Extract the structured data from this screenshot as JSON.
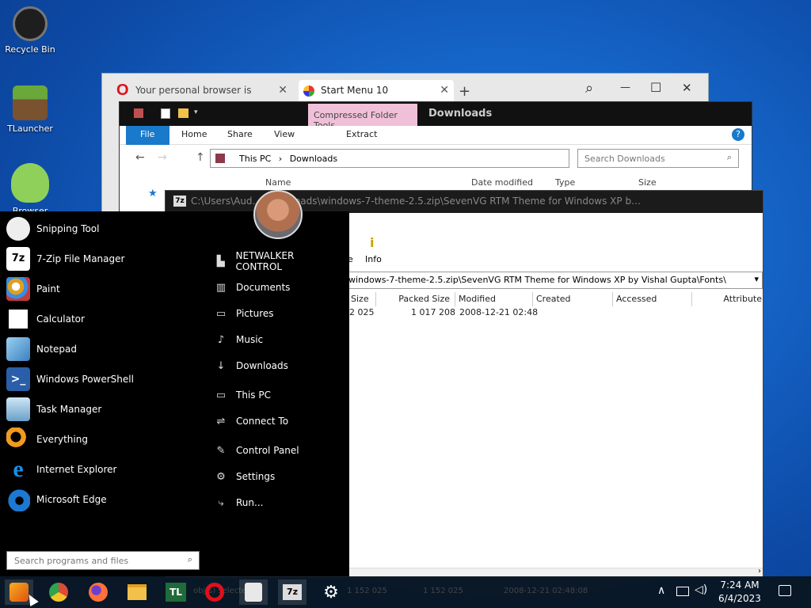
{
  "desktop": {
    "icons": [
      {
        "label": "Recycle Bin",
        "color": "#2a2a2a"
      },
      {
        "label": "TLauncher",
        "color": "#5b8a2e"
      },
      {
        "label": "Browser",
        "color": "#7fc04a"
      }
    ]
  },
  "opera": {
    "tabs": [
      {
        "title": "Your personal browser is"
      },
      {
        "title": "Start Menu 10"
      }
    ],
    "new_tab": "+",
    "search": "⌕",
    "minimize": "—",
    "maximize": "☐",
    "close": "✕",
    "tab_close": "✕"
  },
  "explorer": {
    "title": "Downloads",
    "context_tab": "Compressed Folder Tools",
    "ribbon": {
      "file": "File",
      "home": "Home",
      "share": "Share",
      "view": "View",
      "extract": "Extract"
    },
    "breadcrumb": {
      "root": "This PC",
      "sep": "›",
      "current": "Downloads"
    },
    "search_placeholder": "Search Downloads",
    "columns": [
      "Name",
      "Date modified",
      "Type",
      "Size"
    ]
  },
  "zip": {
    "title": "C:\\Users\\Aud…\\Downloads\\windows-7-theme-2.5.zip\\SevenVG RTM Theme for Windows XP b…",
    "toolbar_info": "Info",
    "toolbar_partial": "e",
    "path": "windows-7-theme-2.5.zip\\SevenVG RTM Theme for Windows XP by Vishal Gupta\\Fonts\\",
    "columns": [
      "Size",
      "Packed Size",
      "Modified",
      "Created",
      "Accessed",
      "Attribute"
    ],
    "row": {
      "size": "2 025",
      "packed": "1 017 208",
      "modified": "2008-12-21 02:48"
    },
    "status": {
      "selected": "obj(s) selected",
      "size": "1 152 025",
      "packed": "1 152 025",
      "modified": "2008-12-21 02:48:08"
    }
  },
  "start_menu": {
    "programs": [
      {
        "label": "Snipping Tool",
        "icon": "snipping-tool-icon",
        "color": "#c23b3b"
      },
      {
        "label": "7-Zip File Manager",
        "icon": "seven-zip-icon",
        "color": "#000000"
      },
      {
        "label": "Paint",
        "icon": "paint-icon",
        "color": "#e0a020"
      },
      {
        "label": "Calculator",
        "icon": "calculator-icon",
        "color": "#ffffff"
      },
      {
        "label": "Notepad",
        "icon": "notepad-icon",
        "color": "#4aa0d8"
      },
      {
        "label": "Windows PowerShell",
        "icon": "powershell-icon",
        "color": "#2a5ea8"
      },
      {
        "label": "Task Manager",
        "icon": "task-manager-icon",
        "color": "#6aa0c8"
      },
      {
        "label": "Everything",
        "icon": "everything-icon",
        "color": "#f09a20"
      },
      {
        "label": "Internet Explorer",
        "icon": "internet-explorer-icon",
        "color": "#1a8de0"
      },
      {
        "label": "Microsoft Edge",
        "icon": "edge-icon",
        "color": "#1c78d0"
      }
    ],
    "places": [
      {
        "label": "NETWALKER CONTROL",
        "icon": "user-folder-icon",
        "glyph": "▙"
      },
      {
        "label": "Documents",
        "icon": "documents-icon",
        "glyph": "▥"
      },
      {
        "label": "Pictures",
        "icon": "pictures-icon",
        "glyph": "▭"
      },
      {
        "label": "Music",
        "icon": "music-icon",
        "glyph": "♪"
      },
      {
        "label": "Downloads",
        "icon": "downloads-icon",
        "glyph": "↓"
      },
      {
        "label": "This PC",
        "icon": "this-pc-icon",
        "glyph": "▭"
      },
      {
        "label": "Connect To",
        "icon": "connect-to-icon",
        "glyph": "⇌"
      },
      {
        "label": "Control Panel",
        "icon": "control-panel-icon",
        "glyph": "✎"
      },
      {
        "label": "Settings",
        "icon": "settings-icon",
        "glyph": "⚙"
      },
      {
        "label": "Run...",
        "icon": "run-icon",
        "glyph": "⤷"
      }
    ],
    "search_placeholder": "Search programs and files"
  },
  "taskbar": {
    "pinned": [
      {
        "name": "chrome-icon",
        "color": "#dd4a38"
      },
      {
        "name": "firefox-icon",
        "color": "#ff7139"
      },
      {
        "name": "file-explorer-icon",
        "color": "#f2c14a"
      },
      {
        "name": "tlauncher-icon",
        "color": "#1f6b3a",
        "text": "TL"
      },
      {
        "name": "opera-icon",
        "color": "#e0101a"
      },
      {
        "name": "java-icon",
        "color": "#e8e8e8"
      },
      {
        "name": "seven-zip-taskbar-icon",
        "color": "#1b1b1b",
        "text": "7z"
      },
      {
        "name": "settings-gear-icon",
        "color": "#000000",
        "text": "⚙"
      }
    ],
    "clock": {
      "time": "7:24 AM",
      "date": "6/4/2023"
    },
    "tray": {
      "chevron": "∧",
      "network": "🖧",
      "volume": "🔊",
      "notifications": "🗨"
    }
  }
}
